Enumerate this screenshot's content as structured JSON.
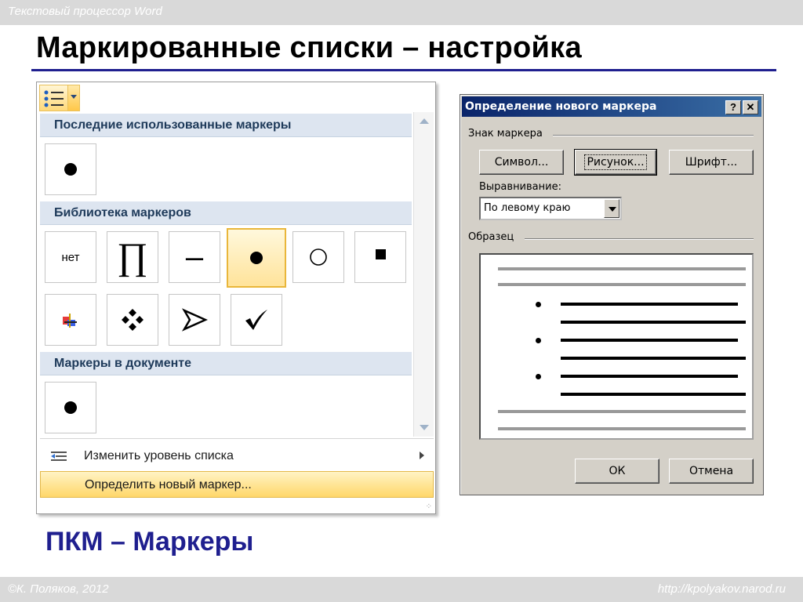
{
  "header": {
    "subtitle": "Текстовый процессор Word",
    "title": "Маркированные списки – настройка"
  },
  "gallery": {
    "sections": {
      "recent": "Последние использованные маркеры",
      "library": "Библиотека маркеров",
      "document": "Маркеры в документе"
    },
    "library_items": [
      "нет",
      "∏",
      "–",
      "•",
      "○",
      "■",
      "",
      "❖",
      "➢",
      "✓"
    ],
    "selected_library_index": 3,
    "menu": {
      "change_level": "Изменить уровень списка",
      "define_new": "Определить новый маркер..."
    }
  },
  "dialog": {
    "title": "Определение нового маркера",
    "help_btn": "?",
    "close_btn": "✕",
    "group_marker": "Знак маркера",
    "btn_symbol": "Символ...",
    "btn_picture": "Рисунок...",
    "btn_font": "Шрифт...",
    "align_label": "Выравнивание:",
    "align_value": "По левому краю",
    "group_sample": "Образец",
    "ok": "ОК",
    "cancel": "Отмена"
  },
  "caption": "ПКМ – Маркеры",
  "footer": {
    "left": "©К. Поляков, 2012",
    "right": "http://kpolyakov.narod.ru"
  }
}
